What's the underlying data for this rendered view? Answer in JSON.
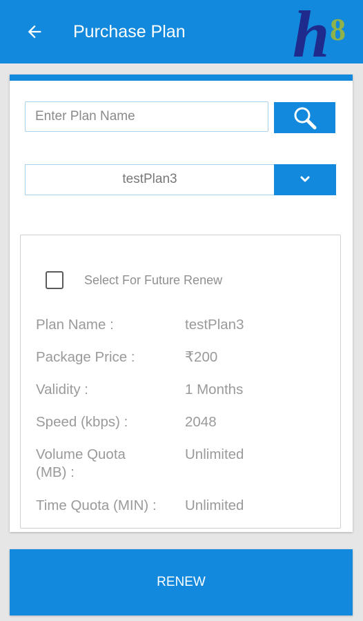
{
  "header": {
    "title": "Purchase Plan",
    "logo_letter": "h",
    "logo_digit": "8"
  },
  "search": {
    "placeholder": "Enter Plan Name",
    "value": ""
  },
  "plan_select": {
    "selected": "testPlan3"
  },
  "future_renew": {
    "label": "Select For Future Renew",
    "checked": false
  },
  "details": {
    "plan_name_label": "Plan Name :",
    "plan_name_value": "testPlan3",
    "price_label": "Package Price :",
    "price_value": "₹200",
    "validity_label": "Validity :",
    "validity_value": "1 Months",
    "speed_label": "Speed (kbps) :",
    "speed_value": "2048",
    "volume_label_line1": "Volume Quota",
    "volume_label_line2": "(MB) :",
    "volume_value": "Unlimited",
    "time_label": "Time Quota (MIN) :",
    "time_value": "Unlimited"
  },
  "actions": {
    "renew_label": "RENEW"
  },
  "colors": {
    "primary": "#1289dc",
    "logo_navy": "#1e2b8c",
    "logo_green": "#8fb34a"
  },
  "icons": {
    "back": "arrow-left-icon",
    "search": "magnifier-icon",
    "dropdown": "chevron-down-icon"
  }
}
